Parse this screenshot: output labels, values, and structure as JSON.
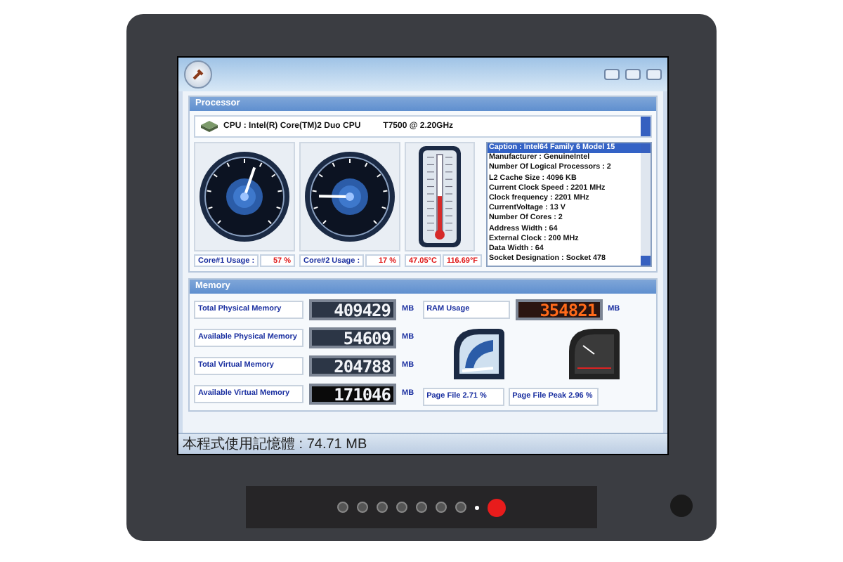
{
  "processor": {
    "title": "Processor",
    "cpu": "CPU : Intel(R) Core(TM)2 Duo CPU",
    "cpu_model": "T7500  @ 2.20GHz",
    "gauges": [
      {
        "label": "Core#1 Usage :",
        "reading": "57 %",
        "level": 0.57
      },
      {
        "label": "Core#2 Usage :",
        "reading": "17 %",
        "level": 0.17
      }
    ],
    "thermometer": {
      "level": 0.47,
      "celsius": "47.05°C",
      "fahrenheit": "116.69°F"
    },
    "details": [
      {
        "text": "Caption : Intel64 Family 6 Model 15",
        "selected": true
      },
      {
        "text": "Manufacturer : GenuineIntel",
        "selected": false
      },
      {
        "text": "Number Of Logical Processors : 2",
        "selected": false
      },
      {
        "text": "L2 Cache Size : 4096 KB",
        "selected": false
      },
      {
        "text": "Current Clock Speed : 2201 MHz",
        "selected": false
      },
      {
        "text": "Clock frequency : 2201 MHz",
        "selected": false
      },
      {
        "text": "CurrentVoltage : 13 V",
        "selected": false
      },
      {
        "text": "Number Of Cores : 2",
        "selected": false
      },
      {
        "text": "Address Width : 64",
        "selected": false
      },
      {
        "text": "External Clock : 200 MHz",
        "selected": false
      },
      {
        "text": "Data Width : 64",
        "selected": false
      },
      {
        "text": "Socket Designation : Socket 478",
        "selected": false
      }
    ]
  },
  "memory": {
    "title": "Memory",
    "rows": [
      {
        "label": "Total Physical Memory",
        "value": "409429",
        "unit": "MB"
      },
      {
        "label": "Available Physical Memory",
        "value": "54609",
        "unit": "MB"
      },
      {
        "label": "Total Virtual Memory",
        "value": "204788",
        "unit": "MB"
      },
      {
        "label": "Available Virtual Memory",
        "value": "171046",
        "unit": "MB"
      }
    ],
    "ram_usage": {
      "label": "RAM Usage",
      "value": "354821",
      "unit": "MB"
    },
    "page_file": "Page File 2.71 %",
    "page_file_peak": "Page File Peak 2.96 %"
  },
  "status_bar": "本程式使用記憶體 : 74.71 MB"
}
